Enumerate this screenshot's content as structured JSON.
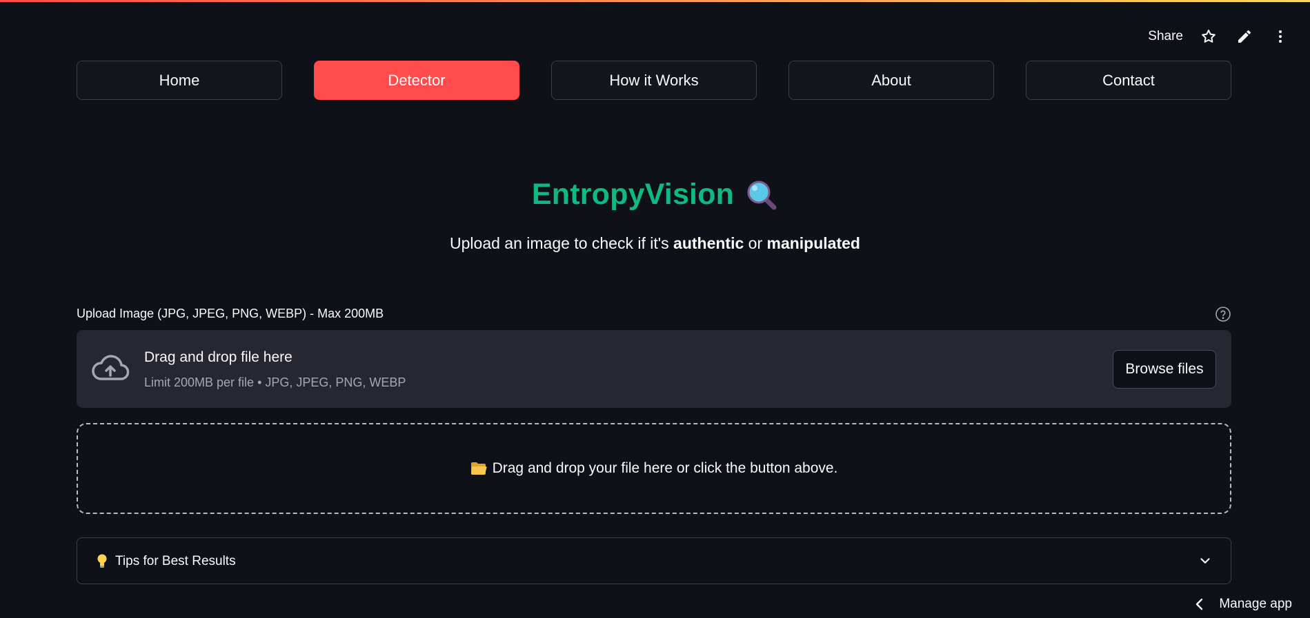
{
  "header": {
    "share_label": "Share",
    "icons": [
      "star-icon",
      "pencil-icon",
      "more-vert-icon"
    ]
  },
  "nav": {
    "items": [
      {
        "label": "Home",
        "active": false
      },
      {
        "label": "Detector",
        "active": true
      },
      {
        "label": "How it Works",
        "active": false
      },
      {
        "label": "About",
        "active": false
      },
      {
        "label": "Contact",
        "active": false
      }
    ]
  },
  "hero": {
    "title": "EntropyVision",
    "title_icon": "magnifier-icon",
    "subtitle_prefix": "Upload an image to check if it's ",
    "subtitle_bold_1": "authentic",
    "subtitle_mid": " or ",
    "subtitle_bold_2": "manipulated"
  },
  "uploader": {
    "label": "Upload Image (JPG, JPEG, PNG, WEBP) - Max 200MB",
    "drop_title": "Drag and drop file here",
    "drop_sub": "Limit 200MB per file • JPG, JPEG, PNG, WEBP",
    "browse_label": "Browse files"
  },
  "hint_box": {
    "text": "Drag and drop your file here or click the button above."
  },
  "expander": {
    "label": "Tips for Best Results"
  },
  "footer": {
    "manage_label": "Manage app"
  },
  "colors": {
    "background": "#0e1117",
    "accent": "#ff4b4b",
    "title": "#10b981",
    "panel": "#262730"
  }
}
